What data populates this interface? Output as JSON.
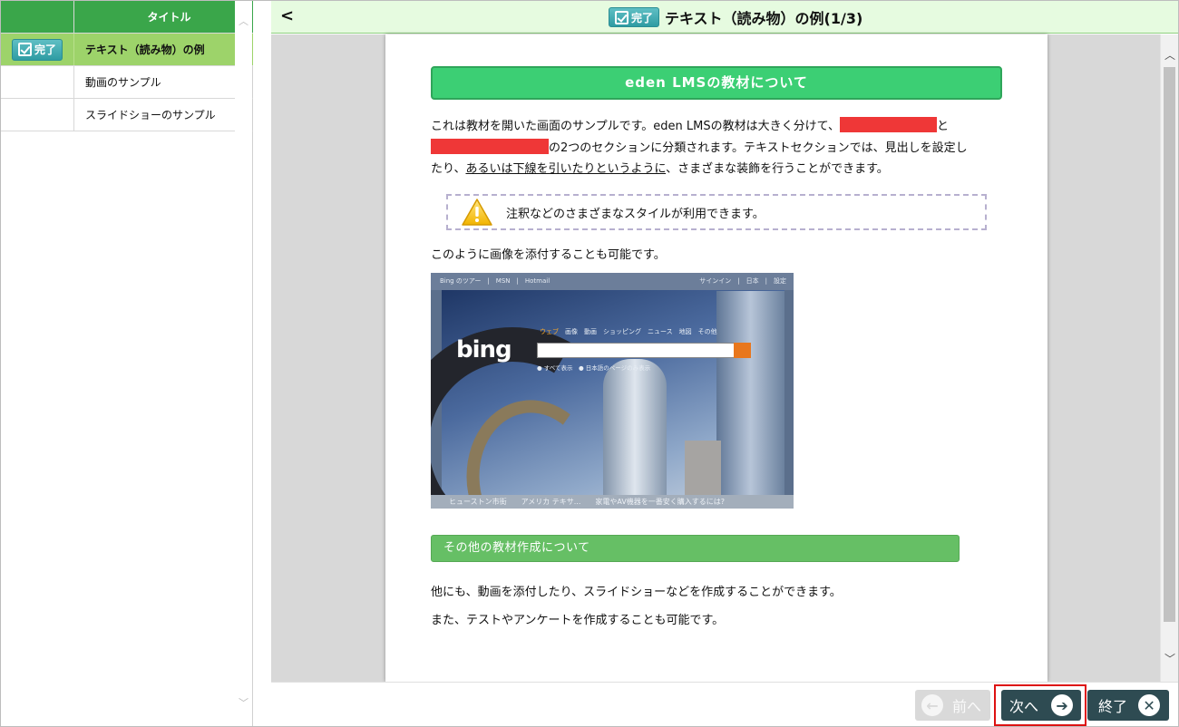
{
  "sidebar": {
    "header_title": "タイトル",
    "items": [
      {
        "status": "完了",
        "label": "テキスト（読み物）の例",
        "active": true
      },
      {
        "status": "",
        "label": "動画のサンプル",
        "active": false
      },
      {
        "status": "",
        "label": "スライドショーのサンプル",
        "active": false
      }
    ]
  },
  "header": {
    "back_label": "<",
    "status_badge": "完了",
    "title": "テキスト（読み物）の例(1/3)"
  },
  "content": {
    "heading": "eden LMSの教材について",
    "para1_line1_a": "これは教材を開いた画面のサンプルです。eden LMSの教材は大きく分けて、",
    "para1_line1_b": "と",
    "para1_line2": "の2つのセクションに分類されます。テキストセクションでは、見出しを設定し",
    "para1_line3_a": "たり、",
    "para1_line3_underlined": "あるいは下線を引いたりというように",
    "para1_line3_b": "、さまざまな装飾を行うことができます。",
    "note": "注釈などのさまざまなスタイルが利用できます。",
    "image_caption": "このように画像を添付することも可能です。",
    "bing": {
      "top_left": "Bing のツアー　|　MSN　|　Hotmail",
      "top_right": "サインイン　|　日本　|　設定",
      "logo": "bing",
      "tab_selected": "ウェブ",
      "tabs": "画像　動画　ショッピング　ニュース　地図　その他",
      "radio1": "すべて表示",
      "radio2": "日本語のページのみ表示",
      "bottom": "ヒューストン市街　　アメリカ テキサ...　　家電やAV機器を一番安く購入するには?"
    },
    "subheading": "その他の教材作成について",
    "para2": "他にも、動画を添付したり、スライドショーなどを作成することができます。",
    "para3": "また、テストやアンケートを作成することも可能です。"
  },
  "footer": {
    "prev_label": "前へ",
    "next_label": "次へ",
    "end_label": "終了"
  },
  "colors": {
    "sidebar_header": "#3aa64a",
    "sidebar_active": "#9dd36a",
    "heading_green": "#3ccf74",
    "subheading_green": "#66bf65",
    "redaction": "#ef3737",
    "footer_button": "#2e4b52",
    "highlight_outline": "#dd1111"
  }
}
